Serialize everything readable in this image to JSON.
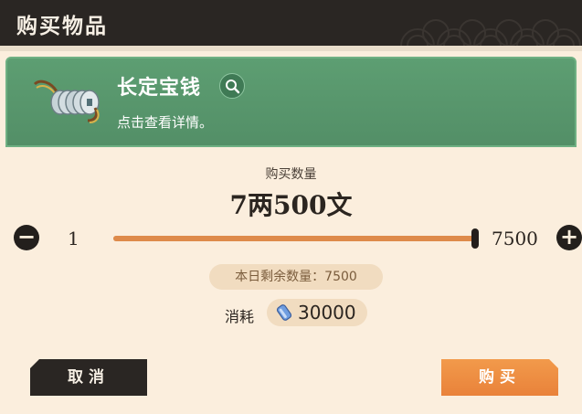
{
  "dialog": {
    "title": "购买物品"
  },
  "item": {
    "name": "长定宝钱",
    "description": "点击查看详情。"
  },
  "purchase": {
    "quantity_label": "购买数量",
    "amount_text": "7两500文",
    "min_value": "1",
    "max_value": "7500",
    "slider_fraction": 1.0,
    "remaining_text": "本日剩余数量：7500",
    "consume_label": "消耗",
    "cost_value": "30000"
  },
  "buttons": {
    "cancel": "取消",
    "buy": "购买"
  },
  "colors": {
    "card_green": "#5d9e72",
    "accent_orange": "#e9823a",
    "dark": "#2a2623",
    "background": "#fbeedd"
  },
  "icons": {
    "item": "coin-string-icon",
    "info": "magnifier-icon",
    "currency": "jade-gem-icon"
  }
}
